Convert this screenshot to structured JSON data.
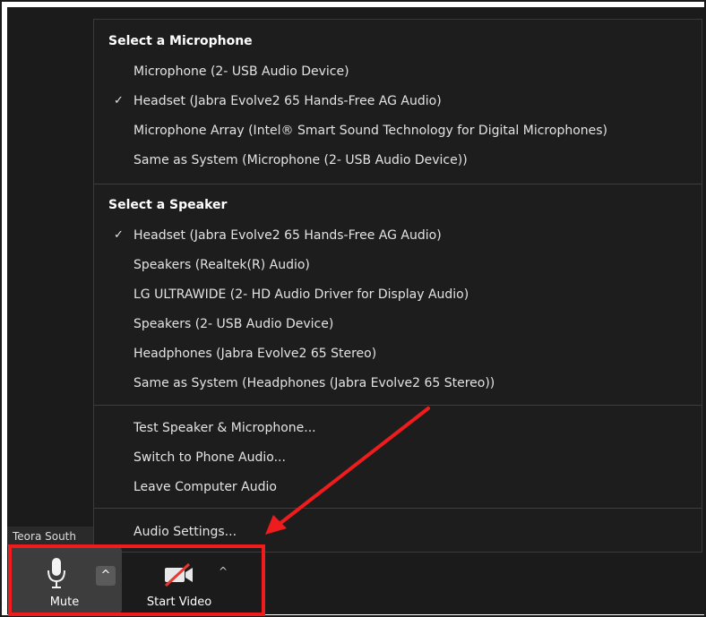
{
  "menu": {
    "microphone_section": {
      "title": "Select a Microphone",
      "items": [
        {
          "label": "Microphone (2- USB Audio Device)",
          "checked": false
        },
        {
          "label": "Headset (Jabra Evolve2 65 Hands-Free AG Audio)",
          "checked": true
        },
        {
          "label": "Microphone Array (Intel® Smart Sound Technology for Digital Microphones)",
          "checked": false
        },
        {
          "label": "Same as System (Microphone (2- USB Audio Device))",
          "checked": false
        }
      ]
    },
    "speaker_section": {
      "title": "Select a Speaker",
      "items": [
        {
          "label": "Headset (Jabra Evolve2 65 Hands-Free AG Audio)",
          "checked": true
        },
        {
          "label": "Speakers (Realtek(R) Audio)",
          "checked": false
        },
        {
          "label": "LG ULTRAWIDE (2- HD Audio Driver for Display Audio)",
          "checked": false
        },
        {
          "label": "Speakers (2- USB Audio Device)",
          "checked": false
        },
        {
          "label": "Headphones (Jabra Evolve2 65 Stereo)",
          "checked": false
        },
        {
          "label": "Same as System (Headphones (Jabra Evolve2 65 Stereo))",
          "checked": false
        }
      ]
    },
    "actions": [
      {
        "label": "Test Speaker & Microphone..."
      },
      {
        "label": "Switch to Phone Audio..."
      },
      {
        "label": "Leave Computer Audio"
      }
    ],
    "settings": {
      "label": "Audio Settings..."
    }
  },
  "check_glyph": "✓",
  "participant": {
    "name": "Teora South"
  },
  "toolbar": {
    "mute_label": "Mute",
    "mute_caret": "^",
    "video_label": "Start Video",
    "video_caret": "^"
  },
  "colors": {
    "background": "#1b1b1b",
    "menu_background": "#1d1d1d",
    "annotation_red": "#ee1c1c"
  }
}
